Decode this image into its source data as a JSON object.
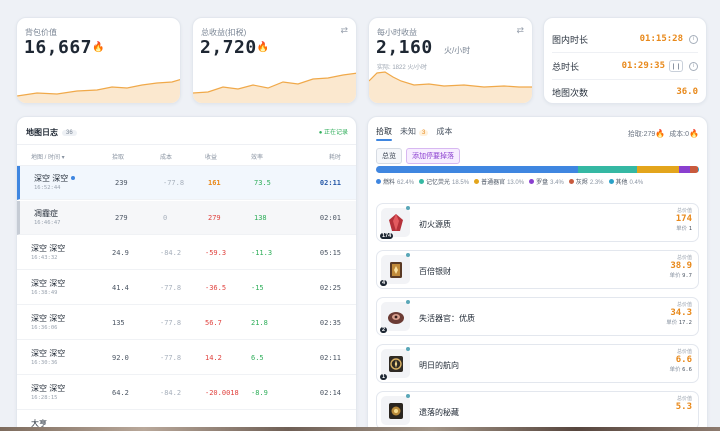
{
  "bag_value": {
    "label": "背包价值",
    "value": "16,667"
  },
  "total_revenue": {
    "label": "总收益(扣税)",
    "value": "2,720"
  },
  "hourly_revenue": {
    "label": "每小时收益",
    "value": "2,160",
    "unit": "火/小时",
    "note": "实际: 1822 火/小时"
  },
  "timers": {
    "map_time_label": "图内时长",
    "map_time_value": "01:15:28",
    "total_time_label": "总时长",
    "total_time_value": "01:29:35",
    "map_count_label": "地图次数",
    "map_count_value": "36.0"
  },
  "map_log": {
    "title": "地图日志",
    "count": "36",
    "recording": "● 正在记录",
    "headers": {
      "name": "地图 / 时间 ▾",
      "pick": "拾取",
      "cost": "成本",
      "revenue": "收益",
      "efficiency": "效率",
      "duration": "耗时"
    },
    "rows": [
      {
        "name": "深空 深空",
        "time": "16:52:44",
        "pick": "239",
        "cost": "-77.8",
        "revenue": "161",
        "efficiency": "73.5",
        "duration": "02:11"
      },
      {
        "name": "凋霾症",
        "time": "16:46:47",
        "pick": "279",
        "cost": "0",
        "revenue": "279",
        "efficiency": "138",
        "duration": "02:01"
      },
      {
        "name": "深空 深空",
        "time": "16:43:32",
        "pick": "24.9",
        "cost": "-84.2",
        "revenue": "-59.3",
        "efficiency": "-11.3",
        "duration": "05:15"
      },
      {
        "name": "深空 深空",
        "time": "16:38:49",
        "pick": "41.4",
        "cost": "-77.8",
        "revenue": "-36.5",
        "efficiency": "-15",
        "duration": "02:25"
      },
      {
        "name": "深空 深空",
        "time": "16:36:06",
        "pick": "135",
        "cost": "-77.8",
        "revenue": "56.7",
        "efficiency": "21.8",
        "duration": "02:35"
      },
      {
        "name": "深空 深空",
        "time": "16:30:36",
        "pick": "92.0",
        "cost": "-77.8",
        "revenue": "14.2",
        "efficiency": "6.5",
        "duration": "02:11"
      },
      {
        "name": "深空 深空",
        "time": "16:28:15",
        "pick": "64.2",
        "cost": "-84.2",
        "revenue": "-20.0018",
        "efficiency": "-8.9",
        "duration": "02:14"
      },
      {
        "name": "大亨",
        "time": "",
        "pick": "",
        "cost": "",
        "revenue": "",
        "efficiency": "",
        "duration": ""
      }
    ]
  },
  "drops": {
    "tabs": {
      "pick": "拾取",
      "unknown": "未知",
      "unknown_count": "3",
      "cost": "成本"
    },
    "summary_pick": "拾取:279",
    "summary_cost": "成本:0",
    "filter_all": "总览",
    "filter_add": "添加停要掉落",
    "legend": [
      {
        "name": "燃料",
        "pct": "62.4%",
        "color": "#3f86e0",
        "share": 62.4
      },
      {
        "name": "记忆荧光",
        "pct": "18.5%",
        "color": "#35b8a3",
        "share": 18.5
      },
      {
        "name": "普通器官",
        "pct": "13.0%",
        "color": "#e3a51c",
        "share": 13.0
      },
      {
        "name": "罗盘",
        "pct": "3.4%",
        "color": "#8a3fcf",
        "share": 3.4
      },
      {
        "name": "灰烬",
        "pct": "2.3%",
        "color": "#c85a3d",
        "share": 2.3
      },
      {
        "name": "其他",
        "pct": "0.4%",
        "color": "#2aa1c8",
        "share": 0.4
      }
    ],
    "items": [
      {
        "name": "初火源质",
        "qty": "174",
        "total_cap": "总价值",
        "total": "174",
        "unit_cap": "单价",
        "unit": "1"
      },
      {
        "name": "百倍银财",
        "qty": "4",
        "total_cap": "总价值",
        "total": "38.9",
        "unit_cap": "单价",
        "unit": "9.7"
      },
      {
        "name": "失活器官：优质",
        "qty": "2",
        "total_cap": "总价值",
        "total": "34.3",
        "unit_cap": "单价",
        "unit": "17.2"
      },
      {
        "name": "明日的航向",
        "qty": "1",
        "total_cap": "总价值",
        "total": "6.6",
        "unit_cap": "单价",
        "unit": "6.6"
      },
      {
        "name": "遗落的秘藏",
        "qty": "",
        "total_cap": "总价值",
        "total": "5.3",
        "unit_cap": "单价",
        "unit": ""
      }
    ]
  }
}
